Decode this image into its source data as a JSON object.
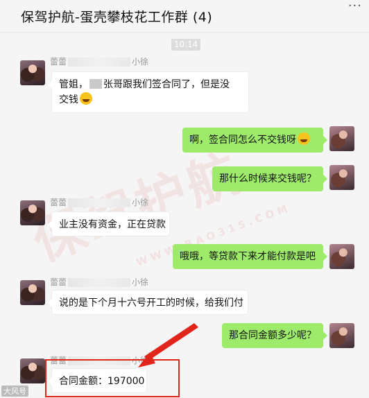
{
  "header": {
    "title": "保驾护航-蛋壳攀枝花工作群 (4)",
    "menu_icon": "more-icon"
  },
  "chat": {
    "timestamp": "10:14",
    "messages": [
      {
        "side": "left",
        "sender_prefix": "蕾蕾",
        "sender_suffix": "小徐",
        "text_prefix": "管姐，",
        "text_middle": "张哥跟我们签合同了，但是没",
        "text_line2": "交钱",
        "emoji": "facepalm-emoji"
      },
      {
        "side": "right",
        "text": "啊，签合同怎么不交钱呀",
        "emoji": "surprised-emoji"
      },
      {
        "side": "right",
        "text": "那什么时候来交钱呢？"
      },
      {
        "side": "left",
        "sender_prefix": "蕾蕾",
        "sender_suffix": "小徐",
        "text": "业主没有资金，正在贷款"
      },
      {
        "side": "right",
        "text": "哦哦，等贷款下来才能付款是吧"
      },
      {
        "side": "left",
        "sender_prefix": "蕾蕾",
        "sender_suffix": "小徐",
        "text": "说的是下个月十六号开工的时候，给我们付"
      },
      {
        "side": "right",
        "text": "那合同金额多少呢？"
      },
      {
        "side": "left",
        "sender_prefix": "蕾蕾",
        "sender_suffix": "小徐",
        "text": "合同金额：197000"
      }
    ]
  },
  "watermark": {
    "text": "保驾护航",
    "sub": "WWW.BAO315.COM"
  },
  "source_mark": "大风号"
}
